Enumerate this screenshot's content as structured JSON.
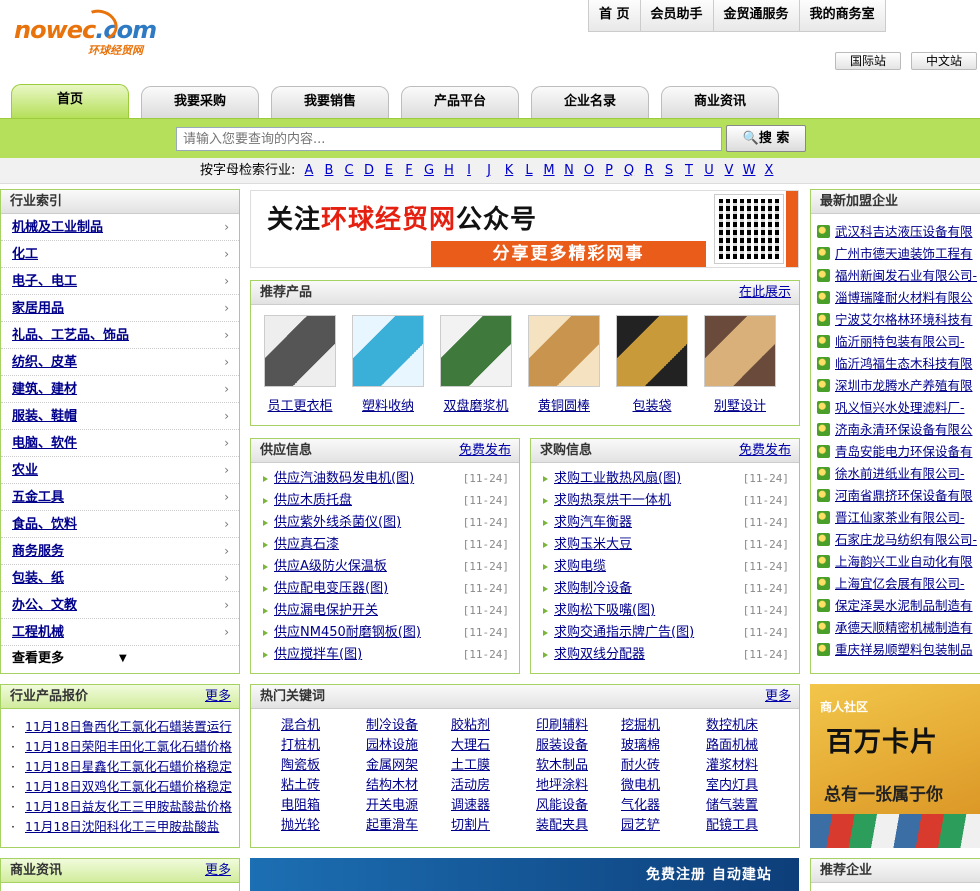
{
  "logo": {
    "main": "nowec",
    "dot": ".com",
    "sub": "环球经贸网"
  },
  "topnav": [
    "首 页",
    "会员助手",
    "金贸通服务",
    "我的商务室"
  ],
  "lang": [
    "国际站",
    "中文站"
  ],
  "tabs": [
    "首页",
    "我要采购",
    "我要销售",
    "产品平台",
    "企业名录",
    "商业资讯"
  ],
  "search": {
    "placeholder": "请输入您要查询的内容...",
    "button": "搜 索"
  },
  "letters": {
    "label": "按字母检索行业:",
    "items": [
      "A",
      "B",
      "C",
      "D",
      "E",
      "F",
      "G",
      "H",
      "I",
      "J",
      "K",
      "L",
      "M",
      "N",
      "O",
      "P",
      "Q",
      "R",
      "S",
      "T",
      "U",
      "V",
      "W",
      "X"
    ]
  },
  "industry": {
    "title": "行业索引",
    "items": [
      "机械及工业制品",
      "化工",
      "电子、电工",
      "家居用品",
      "礼品、工艺品、饰品",
      "纺织、皮革",
      "建筑、建材",
      "服装、鞋帽",
      "电脑、软件",
      "农业",
      "五金工具",
      "食品、饮料",
      "商务服务",
      "包装、纸",
      "办公、文教",
      "工程机械"
    ],
    "more": "查看更多"
  },
  "banner": {
    "line1_a": "关注",
    "line1_b": "环球经贸网",
    "line1_c": "公众号",
    "line2": "分享更多精彩网事"
  },
  "recommend": {
    "title": "推荐产品",
    "more": "在此展示",
    "items": [
      "员工更衣柜",
      "塑料收纳",
      "双盘磨浆机",
      "黄铜圆棒",
      "包装袋",
      "别墅设计"
    ]
  },
  "supply": {
    "title": "供应信息",
    "more": "免费发布",
    "items": [
      {
        "text": "供应汽油数码发电机(图)",
        "date": "[11-24]"
      },
      {
        "text": "供应木质托盘",
        "date": "[11-24]"
      },
      {
        "text": "供应紫外线杀菌仪(图)",
        "date": "[11-24]"
      },
      {
        "text": "供应真石漆",
        "date": "[11-24]"
      },
      {
        "text": "供应A级防火保温板",
        "date": "[11-24]"
      },
      {
        "text": "供应配电变压器(图)",
        "date": "[11-24]"
      },
      {
        "text": "供应漏电保护开关",
        "date": "[11-24]"
      },
      {
        "text": "供应NM450耐磨钢板(图)",
        "date": "[11-24]"
      },
      {
        "text": "供应搅拌车(图)",
        "date": "[11-24]"
      }
    ]
  },
  "purchase": {
    "title": "求购信息",
    "more": "免费发布",
    "items": [
      {
        "text": "求购工业散热风扇(图)",
        "date": "[11-24]"
      },
      {
        "text": "求购热泵烘干一体机",
        "date": "[11-24]"
      },
      {
        "text": "求购汽车衡器",
        "date": "[11-24]"
      },
      {
        "text": "求购玉米大豆",
        "date": "[11-24]"
      },
      {
        "text": "求购电缆",
        "date": "[11-24]"
      },
      {
        "text": "求购制冷设备",
        "date": "[11-24]"
      },
      {
        "text": "求购松下吸嘴(图)",
        "date": "[11-24]"
      },
      {
        "text": "求购交通指示牌广告(图)",
        "date": "[11-24]"
      },
      {
        "text": "求购双线分配器",
        "date": "[11-24]"
      }
    ]
  },
  "newcomp": {
    "title": "最新加盟企业",
    "items": [
      "武汉科吉达液压设备有限",
      "广州市德天迪装饰工程有",
      "福州新闽发石业有限公司-",
      "淄博瑞隆耐火材料有限公",
      "宁波艾尔格林环境科技有",
      "临沂丽特包装有限公司-",
      "临沂鸿福生态木科技有限",
      "深圳市龙腾水产养殖有限",
      "巩义恒兴水处理滤料厂-",
      "济南永清环保设备有限公",
      "青岛安能电力环保设备有",
      "徐水前进纸业有限公司-",
      "河南省鼎挤环保设备有限",
      "晋江仙家茶业有限公司-",
      "石家庄龙马纺织有限公司-",
      "上海韵兴工业自动化有限",
      "上海宜亿会展有限公司-",
      "保定泽昊水泥制品制造有",
      "承德天顺精密机械制造有",
      "重庆祥易顺塑料包装制品"
    ]
  },
  "price": {
    "title": "行业产品报价",
    "more": "更多",
    "items": [
      "11月18日鲁西化工氯化石蜡装置运行",
      "11月18日荣阳丰田化工氯化石蜡价格",
      "11月18日星鑫化工氯化石蜡价格稳定",
      "11月18日双鸡化工氯化石蜡价格稳定",
      "11月18日益友化工三甲胺盐酸盐价格",
      "11月18日沈阳科化工三甲胺盐酸盐"
    ]
  },
  "keywords": {
    "title": "热门关键词",
    "more": "更多",
    "items": [
      "混合机",
      "制冷设备",
      "胶粘剂",
      "印刷辅料",
      "挖掘机",
      "数控机床",
      "打桩机",
      "园林设施",
      "大理石",
      "服装设备",
      "玻璃棉",
      "路面机械",
      "陶瓷板",
      "金属网架",
      "土工膜",
      "软木制品",
      "耐火砖",
      "灌浆材料",
      "粘土砖",
      "结构木材",
      "活动房",
      "地坪涂料",
      "微电机",
      "室内灯具",
      "电阻箱",
      "开关电源",
      "调速器",
      "风能设备",
      "气化器",
      "储气装置",
      "抛光轮",
      "起重滑车",
      "切割片",
      "装配夹具",
      "园艺铲",
      "配镜工具"
    ]
  },
  "ad": {
    "l1": "商人社区",
    "l2": "百万卡片",
    "l3": "总有一张属于你"
  },
  "news": {
    "title": "商业资讯",
    "more": "更多"
  },
  "regbanner": {
    "text": "免费注册 自动建站"
  },
  "reccomp": {
    "title": "推荐企业"
  },
  "colors": {
    "green_border": "#a6d163",
    "search_bar": "#b5e05c",
    "link": "#00008b",
    "orange": "#e95c1a"
  }
}
